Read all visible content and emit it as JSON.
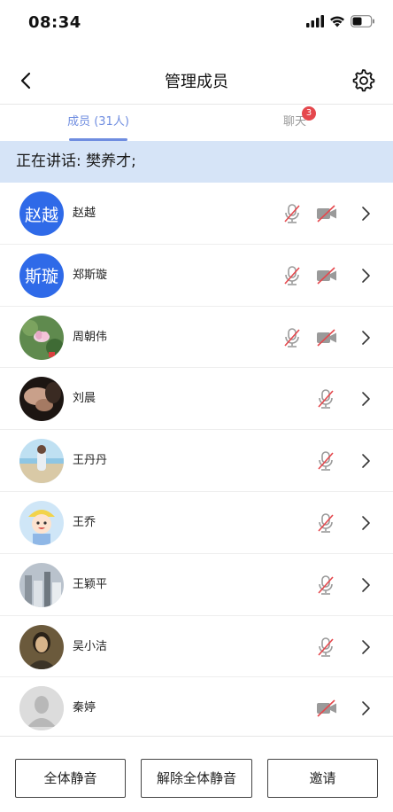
{
  "status_bar": {
    "time": "08:34"
  },
  "nav": {
    "title": "管理成员"
  },
  "tabs": {
    "members": "成员 (31人)",
    "chat": "聊天",
    "chat_badge": "3"
  },
  "speaking": {
    "text": "正在讲话: 樊养才;"
  },
  "members": [
    {
      "name": "赵越",
      "avatar_text": "赵越",
      "avatar": "text-avatar",
      "mic_muted": true,
      "cam_off": true
    },
    {
      "name": "郑斯璇",
      "avatar_text": "斯璇",
      "avatar": "text-avatar",
      "mic_muted": true,
      "cam_off": true
    },
    {
      "name": "周朝伟",
      "avatar": "photo-flower",
      "mic_muted": true,
      "cam_off": true
    },
    {
      "name": "刘晨",
      "avatar": "photo-dark",
      "mic_muted": true,
      "cam_off": false
    },
    {
      "name": "王丹丹",
      "avatar": "photo-beach",
      "mic_muted": true,
      "cam_off": false
    },
    {
      "name": "王乔",
      "avatar": "photo-cartoon",
      "mic_muted": true,
      "cam_off": false
    },
    {
      "name": "王颖平",
      "avatar": "photo-city",
      "mic_muted": true,
      "cam_off": false
    },
    {
      "name": "吴小洁",
      "avatar": "photo-painting",
      "mic_muted": true,
      "cam_off": false
    },
    {
      "name": "秦婷",
      "avatar": "default-avatar",
      "mic_muted": false,
      "cam_off": true
    }
  ],
  "buttons": {
    "mute_all": "全体静音",
    "unmute_all": "解除全体静音",
    "invite": "邀请"
  },
  "colors": {
    "accent": "#6f8de0",
    "banner_bg": "#d6e4f7",
    "avatar_blue": "#2f6ae8",
    "muted_red": "#e5484d",
    "badge": "#e5484d"
  }
}
